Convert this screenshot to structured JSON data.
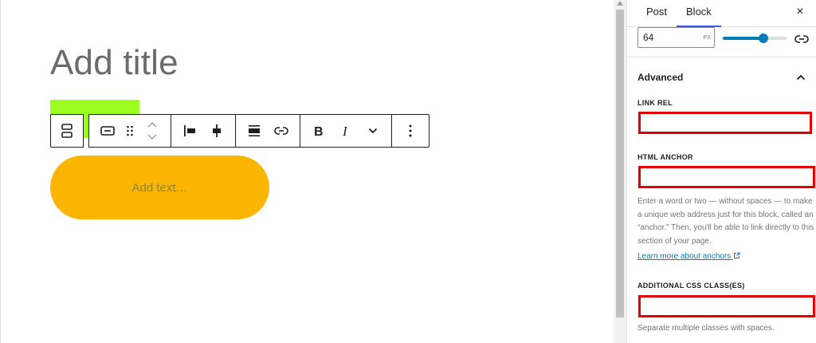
{
  "editor": {
    "title_placeholder": "Add title",
    "button_placeholder": "Add text…"
  },
  "toolbar": {
    "buttons": [
      {
        "name": "block-type-icon"
      },
      {
        "name": "button-block-icon"
      },
      {
        "name": "drag-handle-icon"
      },
      {
        "name": "move-up-down-icon"
      },
      {
        "name": "justify-left-icon"
      },
      {
        "name": "justify-center-icon"
      },
      {
        "name": "align-icon"
      },
      {
        "name": "link-icon"
      },
      {
        "name": "bold-icon"
      },
      {
        "name": "italic-icon"
      },
      {
        "name": "more-rich-text-icon"
      },
      {
        "name": "options-icon"
      }
    ]
  },
  "sidebar": {
    "tabs": [
      {
        "label": "Post",
        "active": false
      },
      {
        "label": "Block",
        "active": true
      }
    ],
    "close_label": "×",
    "width_input": {
      "value": "64",
      "unit": "PX"
    },
    "slider_fraction": 0.64,
    "advanced": {
      "heading": "Advanced",
      "link_rel_label": "LINK REL",
      "html_anchor_label": "HTML ANCHOR",
      "anchor_help": "Enter a word or two — without spaces — to make a unique web address just for this block, called an “anchor.” Then, you'll be able to link directly to this section of your page.",
      "anchor_learn_more": "Learn more about anchors",
      "css_class_label": "ADDITIONAL CSS CLASS(ES)",
      "css_class_help": "Separate multiple classes with spaces."
    }
  },
  "colors": {
    "button_bg": "#fcb500",
    "green_block": "#9dff1f",
    "accent": "#007cba",
    "tab_underline": "#3858e9",
    "highlight_border": "#e00000"
  }
}
